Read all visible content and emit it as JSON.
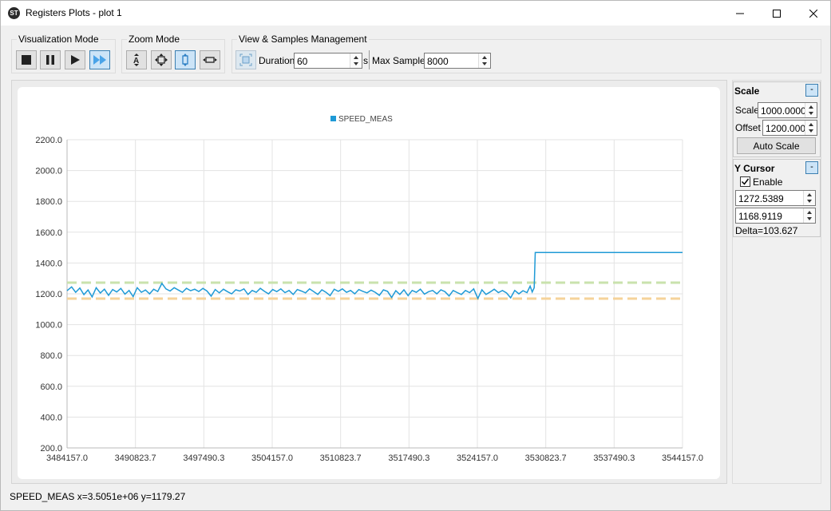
{
  "window": {
    "title": "Registers Plots - plot 1",
    "app_icon": "app-logo-icon"
  },
  "toolbar": {
    "visualization_mode": {
      "label": "Visualization Mode",
      "buttons": [
        "stop-icon",
        "pause-icon",
        "play-icon",
        "fast-forward-icon"
      ],
      "active": "fast-forward-icon"
    },
    "zoom_mode": {
      "label": "Zoom Mode",
      "buttons": [
        "zoom-vertical-text-icon",
        "zoom-move-icon",
        "zoom-vertical-icon",
        "zoom-horizontal-icon"
      ],
      "active": "zoom-vertical-icon"
    },
    "view_samples": {
      "label": "View & Samples Management",
      "duration_label": "Duration",
      "duration_value": "60",
      "duration_unit": "s",
      "max_samples_label": "Max Samples",
      "max_samples_value": "8000"
    }
  },
  "scale_panel": {
    "title": "Scale",
    "collapse": "-",
    "scale_label": "Scale",
    "scale_value": "1000.0000",
    "offset_label": "Offset",
    "offset_value": "1200.0000",
    "auto_scale_label": "Auto Scale"
  },
  "y_cursor_panel": {
    "title": "Y Cursor",
    "collapse": "-",
    "enable_label": "Enable",
    "enabled": true,
    "cursor1": "1272.5389",
    "cursor2": "1168.9119",
    "delta": "Delta=103.627"
  },
  "status": {
    "text": "SPEED_MEAS x=3.5051e+06 y=1179.27"
  },
  "chart_data": {
    "type": "line",
    "title": "",
    "xlabel": "",
    "ylabel": "",
    "xlim": [
      3484157.0,
      3544157.0
    ],
    "ylim": [
      200.0,
      2200.0
    ],
    "x_ticks": [
      "3484157.0",
      "3490823.7",
      "3497490.3",
      "3504157.0",
      "3510823.7",
      "3517490.3",
      "3524157.0",
      "3530823.7",
      "3537490.3",
      "3544157.0"
    ],
    "y_ticks": [
      "200.0",
      "400.0",
      "600.0",
      "800.0",
      "1000.0",
      "1200.0",
      "1400.0",
      "1600.0",
      "1800.0",
      "2000.0",
      "2200.0"
    ],
    "grid": true,
    "legend": "top-center",
    "series": [
      {
        "name": "SPEED_MEAS",
        "color": "#1f9ad6",
        "x": [
          3484157,
          3484600,
          3485000,
          3485400,
          3485800,
          3486200,
          3486600,
          3487000,
          3487400,
          3487800,
          3488200,
          3488600,
          3489000,
          3489400,
          3489800,
          3490200,
          3490600,
          3491000,
          3491400,
          3491800,
          3492200,
          3492600,
          3493000,
          3493400,
          3493800,
          3494200,
          3494600,
          3495000,
          3495400,
          3495800,
          3496200,
          3496600,
          3497000,
          3497400,
          3497800,
          3498200,
          3498600,
          3499000,
          3499400,
          3499800,
          3500200,
          3500600,
          3501000,
          3501400,
          3501800,
          3502200,
          3502600,
          3503000,
          3503400,
          3503800,
          3504200,
          3504600,
          3505000,
          3505400,
          3505800,
          3506200,
          3506600,
          3507000,
          3507400,
          3507800,
          3508200,
          3508600,
          3509000,
          3509400,
          3509800,
          3510200,
          3510600,
          3511000,
          3511400,
          3511800,
          3512200,
          3512600,
          3513000,
          3513400,
          3513800,
          3514200,
          3514600,
          3515000,
          3515400,
          3515800,
          3516200,
          3516600,
          3517000,
          3517400,
          3517800,
          3518200,
          3518600,
          3519000,
          3519400,
          3519800,
          3520200,
          3520600,
          3521000,
          3521400,
          3521800,
          3522200,
          3522600,
          3523000,
          3523400,
          3523800,
          3524200,
          3524600,
          3525000,
          3525400,
          3525800,
          3526200,
          3526600,
          3527000,
          3527400,
          3527800,
          3528200,
          3528600,
          3529000,
          3529300,
          3529500,
          3529700,
          3529800,
          3544157
        ],
        "y": [
          1220,
          1245,
          1210,
          1238,
          1195,
          1225,
          1180,
          1240,
          1205,
          1230,
          1190,
          1228,
          1212,
          1235,
          1198,
          1222,
          1182,
          1240,
          1210,
          1225,
          1200,
          1230,
          1215,
          1268,
          1232,
          1218,
          1240,
          1225,
          1210,
          1236,
          1220,
          1230,
          1215,
          1235,
          1218,
          1185,
          1228,
          1206,
          1230,
          1214,
          1200,
          1226,
          1218,
          1232,
          1196,
          1222,
          1210,
          1236,
          1216,
          1200,
          1228,
          1214,
          1232,
          1208,
          1222,
          1196,
          1228,
          1218,
          1206,
          1232,
          1214,
          1196,
          1226,
          1210,
          1188,
          1230,
          1216,
          1232,
          1210,
          1222,
          1200,
          1228,
          1216,
          1206,
          1224,
          1210,
          1190,
          1226,
          1216,
          1176,
          1220,
          1196,
          1226,
          1188,
          1222,
          1210,
          1230,
          1198,
          1214,
          1222,
          1200,
          1226,
          1214,
          1186,
          1222,
          1208,
          1196,
          1222,
          1208,
          1232,
          1170,
          1226,
          1196,
          1212,
          1230,
          1208,
          1222,
          1206,
          1174,
          1222,
          1200,
          1220,
          1208,
          1250,
          1212,
          1240,
          1468,
          1468
        ]
      }
    ],
    "cursors": [
      {
        "name": "cursor-1",
        "y": 1272.5389,
        "color": "#c9e2ad"
      },
      {
        "name": "cursor-2",
        "y": 1168.9119,
        "color": "#f5d39a"
      }
    ]
  }
}
